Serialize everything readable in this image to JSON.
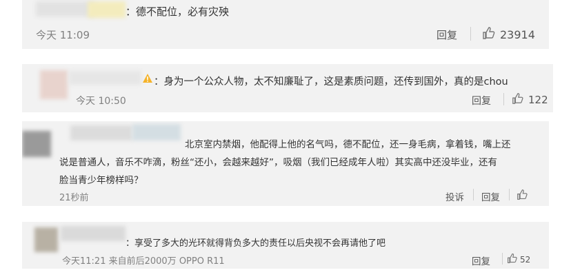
{
  "comments": [
    {
      "text": "：德不配位，必有灾殃",
      "time": "今天 11:09",
      "reply_label": "回复",
      "likes": "23914"
    },
    {
      "text": "：身为一个公众人物，太不知廉耻了，这是素质问题，还传到国外，真的是chou",
      "time": "今天 10:50",
      "reply_label": "回复",
      "likes": "122"
    },
    {
      "text_lines": [
        "北京室内禁烟，他配得上他的名气吗，德不配位，还一身毛病，拿着钱，嘴上还",
        "说是普通人，音乐不咋滴，粉丝“还小，会越来越好”，吸烟（我们已经成年人啦）其实高中还没毕业，还有",
        "脸当青少年榜样吗？"
      ],
      "time": "21秒前",
      "report_label": "投诉",
      "reply_label": "回复",
      "likes": ""
    },
    {
      "text": "：享受了多大的光环就得背负多大的责任以后央视不会再请他了吧",
      "time": "今天11:21 来自前后2000万 OPPO R11",
      "reply_label": "回复",
      "likes": "52"
    }
  ],
  "icons": {
    "like": "thumbs-up-icon",
    "warning": "warning-icon"
  },
  "colors": {
    "card_bg": "#f2f2f2",
    "meta_text": "#808080",
    "body_text": "#333333"
  }
}
